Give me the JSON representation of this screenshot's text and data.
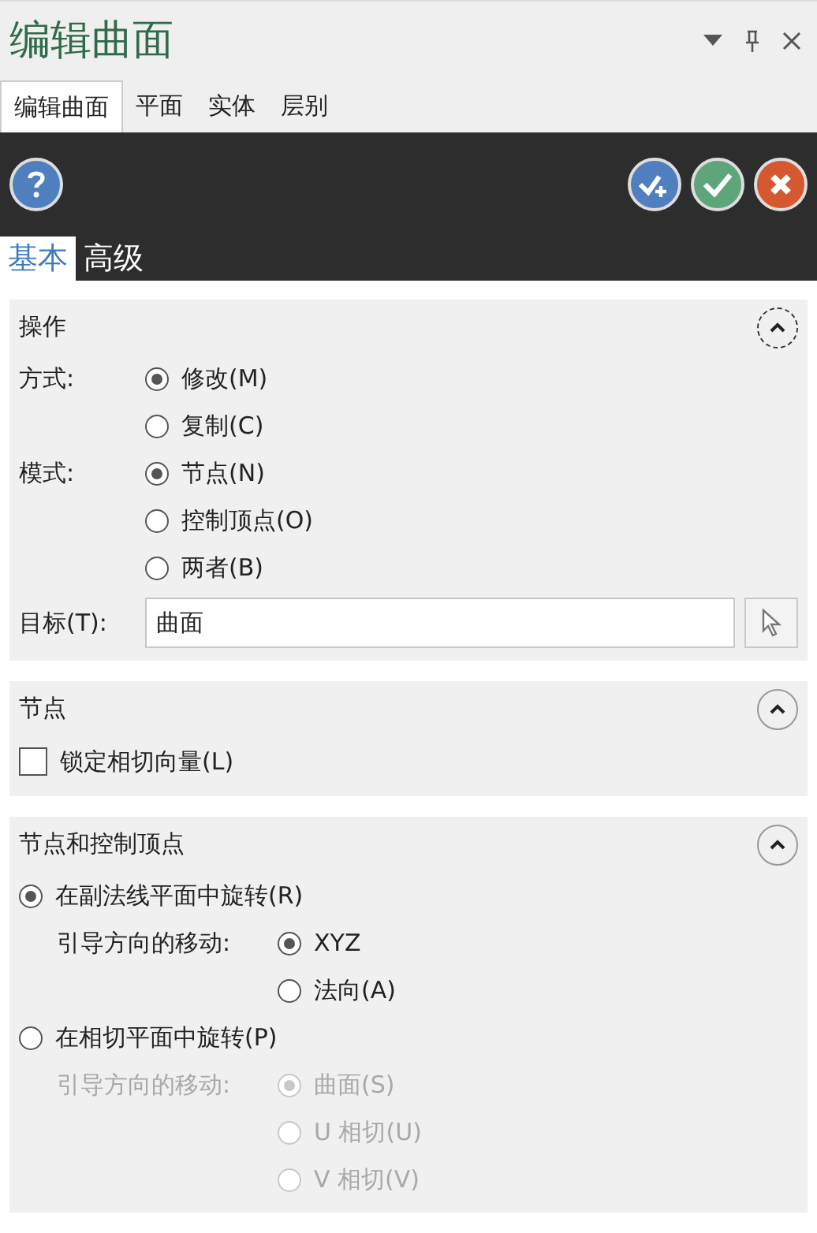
{
  "window": {
    "title": "编辑曲面"
  },
  "tabs": [
    {
      "label": "编辑曲面",
      "selected": true
    },
    {
      "label": "平面",
      "selected": false
    },
    {
      "label": "实体",
      "selected": false
    },
    {
      "label": "层别",
      "selected": false
    }
  ],
  "subtabs": [
    {
      "label": "基本",
      "selected": true
    },
    {
      "label": "高级",
      "selected": false
    }
  ],
  "sections": [
    {
      "title": "操作",
      "expanded": true,
      "focused": true,
      "items": [
        {
          "kind": "radio_group",
          "label": "方式:",
          "disabled": false,
          "options": [
            {
              "label": "修改(M)",
              "selected": true
            },
            {
              "label": "复制(C)",
              "selected": false
            }
          ]
        },
        {
          "kind": "radio_group",
          "label": "模式:",
          "disabled": false,
          "options": [
            {
              "label": "节点(N)",
              "selected": true
            },
            {
              "label": "控制顶点(O)",
              "selected": false
            },
            {
              "label": "两者(B)",
              "selected": false
            }
          ]
        },
        {
          "kind": "field",
          "label": "目标(T):",
          "value": "曲面"
        }
      ]
    },
    {
      "title": "节点",
      "expanded": true,
      "focused": false,
      "items": [
        {
          "kind": "checkbox",
          "label": "锁定相切向量(L)",
          "checked": false
        }
      ]
    },
    {
      "title": "节点和控制顶点",
      "expanded": true,
      "focused": false,
      "items": [
        {
          "kind": "radio",
          "label": "在副法线平面中旋转(R)",
          "selected": true,
          "children": [
            {
              "kind": "radio_group",
              "label": "引导方向的移动:",
              "disabled": false,
              "options": [
                {
                  "label": "XYZ",
                  "selected": true
                },
                {
                  "label": "法向(A)",
                  "selected": false
                }
              ]
            }
          ]
        },
        {
          "kind": "radio",
          "label": "在相切平面中旋转(P)",
          "selected": false,
          "children": [
            {
              "kind": "radio_group",
              "label": "引导方向的移动:",
              "disabled": true,
              "options": [
                {
                  "label": "曲面(S)",
                  "selected": true
                },
                {
                  "label": "U 相切(U)",
                  "selected": false
                },
                {
                  "label": "V 相切(V)",
                  "selected": false
                }
              ]
            }
          ]
        }
      ]
    }
  ]
}
